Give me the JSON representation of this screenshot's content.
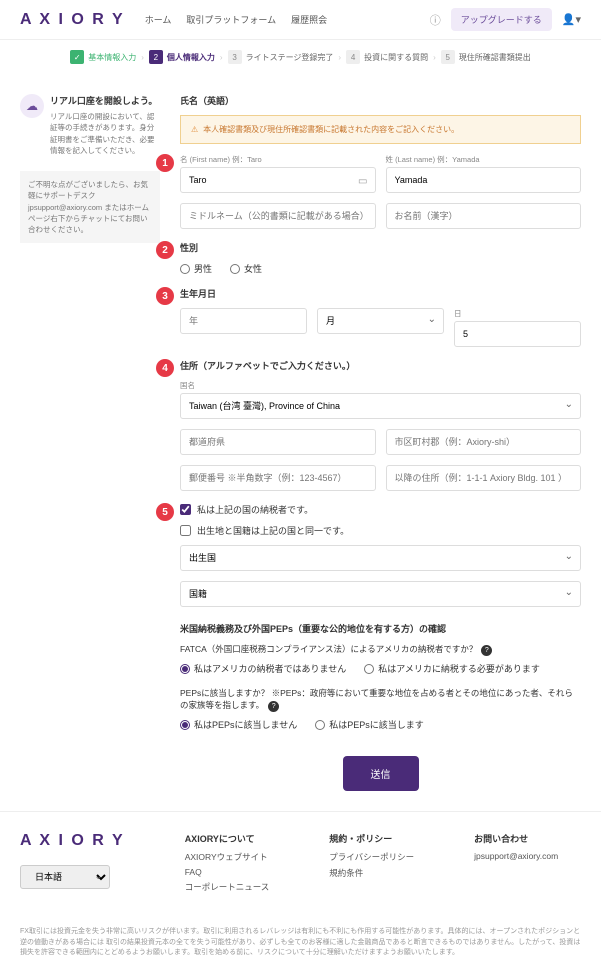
{
  "header": {
    "logo": "A X I O R Y",
    "nav": [
      "ホーム",
      "取引プラットフォーム",
      "履歴照会"
    ],
    "upgrade": "アップグレードする"
  },
  "steps": [
    {
      "num": "✓",
      "label": "基本情報入力"
    },
    {
      "num": "2",
      "label": "個人情報入力"
    },
    {
      "num": "3",
      "label": "ライトステージ登録完了"
    },
    {
      "num": "4",
      "label": "投資に関する質問"
    },
    {
      "num": "5",
      "label": "現住所確認書類提出"
    }
  ],
  "sidebar": {
    "title": "リアル口座を開設しよう。",
    "text": "リアル口座の開設において、認証等の手続きがあります。身分証明書をご準備いただき、必要情報を記入してください。",
    "support": "ご不明な点がございましたら、お気軽にサポートデスク jpsupport@axiory.com またはホームページ右下からチャットにてお問い合わせください。"
  },
  "form": {
    "nameTitle": "氏名（英語）",
    "warning": "本人確認書類及び現住所確認書類に記載された内容をご記入ください。",
    "firstNameLabel": "名 (First name)  例：Taro",
    "firstName": "Taro",
    "lastNameLabel": "姓 (Last name)  例：Yamada",
    "lastName": "Yamada",
    "middleName": "ミドルネーム（公的書類に記載がある場合）",
    "kanjiName": "お名前（漢字）",
    "genderTitle": "性別",
    "genderM": "男性",
    "genderF": "女性",
    "dobTitle": "生年月日",
    "year": "年",
    "month": "月",
    "dayLabel": "日",
    "day": "5",
    "addressTitle": "住所（アルファベットでご入力ください。）",
    "countryLabel": "国名",
    "country": "Taiwan (台湾 臺灣), Province of China",
    "prefecture": "都道府県",
    "city": "市区町村郡（例：Axiory-shi）",
    "postal": "郵便番号 ※半角数字（例：123-4567）",
    "addressDetail": "以降の住所（例：1-1-1 Axiory Bldg. 101 ）",
    "tax1": "私は上記の国の納税者です。",
    "tax2": "出生地と国籍は上記の国と同一です。",
    "birthplace": "出生国",
    "nationality": "国籍",
    "pepTitle": "米国納税義務及び外国PEPs（重要な公的地位を有する方）の確認",
    "fatcaQ": "FATCA（外国口座税務コンプライアンス法）によるアメリカの納税者ですか？",
    "fatcaNo": "私はアメリカの納税者ではありません",
    "fatcaYes": "私はアメリカに納税する必要があります",
    "pepQ": "PEPsに該当しますか？ ※PEPs：政府等において重要な地位を占める者とその地位にあった者、それらの家族等を指します。",
    "pepNo": "私はPEPsに該当しません",
    "pepYes": "私はPEPsに該当します",
    "submit": "送信"
  },
  "footer": {
    "cols": [
      {
        "title": "AXIORYについて",
        "links": [
          "AXIORYウェブサイト",
          "FAQ",
          "コーポレートニュース"
        ]
      },
      {
        "title": "規約・ポリシー",
        "links": [
          "プライバシーポリシー",
          "規約条件"
        ]
      },
      {
        "title": "お問い合わせ",
        "links": [
          "jpsupport@axiory.com"
        ]
      }
    ],
    "lang": "日本語"
  },
  "disclaimer": "FX取引には投資元金を失う非常に高いリスクが伴います。取引に利用されるレバレッジは有利にも不利にも作用する可能性があります。具体的には、オープンされたポジションと逆の値動きがある場合には 取引の結果投資元本の全てを失う可能性があり、必ずしも全てのお客様に適した金融商品であると断言できるものではありません。したがって、投資は損失を許容できる範囲内にとどめるようお願いします。取引を始める前に、リスクについて十分に理解いただけますようお願いいたします。"
}
